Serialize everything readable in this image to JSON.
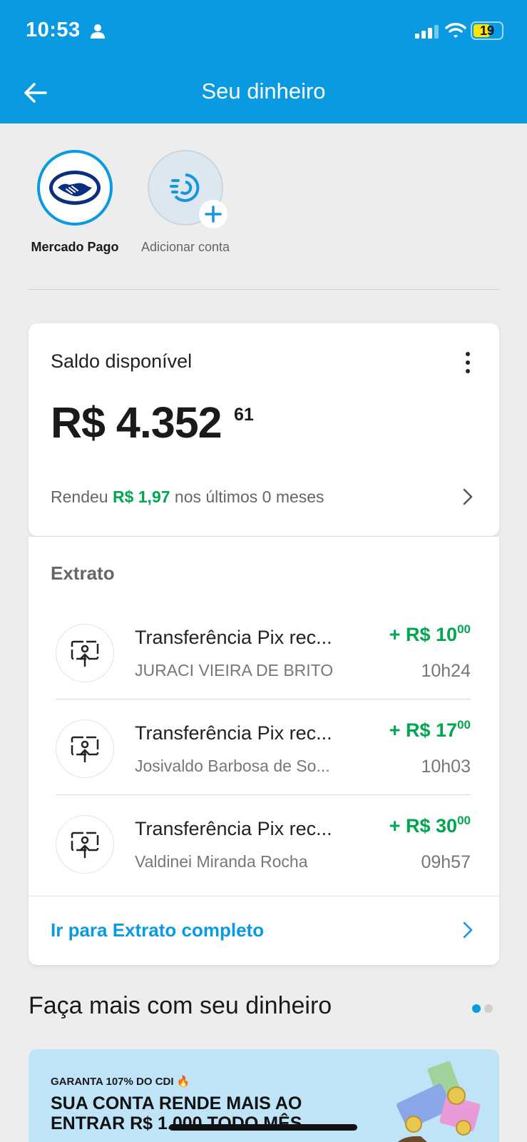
{
  "status_bar": {
    "time": "10:53",
    "battery": "19"
  },
  "header": {
    "title": "Seu dinheiro"
  },
  "accounts": [
    {
      "label": "Mercado Pago"
    },
    {
      "label": "Adicionar conta"
    }
  ],
  "balance": {
    "label": "Saldo disponível",
    "amount": "R$ 4.352",
    "cents": "61",
    "earn_prefix": "Rendeu",
    "earn_value": "R$ 1,97",
    "earn_suffix": "nos últimos 0 meses"
  },
  "extrato": {
    "title": "Extrato",
    "transactions": [
      {
        "title": "Transferência Pix rec...",
        "name": "JURACI VIEIRA DE BRITO",
        "amount": "+ R$ 10",
        "cents": "00",
        "time": "10h24"
      },
      {
        "title": "Transferência Pix rec...",
        "name": "Josivaldo Barbosa de So...",
        "amount": "+ R$ 17",
        "cents": "00",
        "time": "10h03"
      },
      {
        "title": "Transferência Pix rec...",
        "name": "Valdinei Miranda Rocha",
        "amount": "+ R$ 30",
        "cents": "00",
        "time": "09h57"
      }
    ],
    "link_label": "Ir para Extrato completo"
  },
  "more": {
    "title": "Faça mais com seu dinheiro"
  },
  "promo": {
    "kicker": "GARANTA 107% DO CDI 🔥",
    "headline": "SUA CONTA RENDE MAIS AO ENTRAR R$ 1.000 TODO MÊS"
  },
  "colors": {
    "brand": "#0a9ae2",
    "positive": "#00a650"
  }
}
